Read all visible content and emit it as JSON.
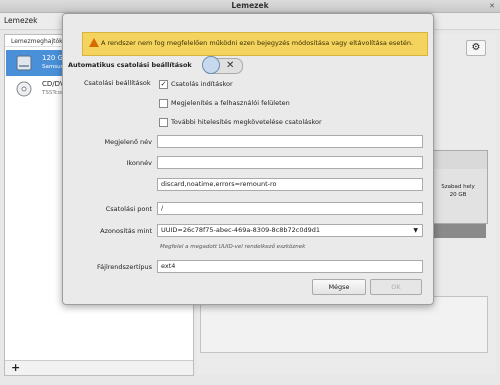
{
  "window": {
    "title": "Lemezek",
    "close_glyph": "✕"
  },
  "menubar": {
    "menu_label": "Lemezek"
  },
  "sidebar": {
    "header": "Lemezmeghajtók",
    "drives": [
      {
        "name": "120 GB",
        "sub": "Samsung"
      },
      {
        "name": "CD/DVD",
        "sub": "TSSTcorp"
      }
    ],
    "add_glyph": "+"
  },
  "content": {
    "gear_glyph": "⚙",
    "free_space": {
      "label": "Szabad hely",
      "size": "20 GB"
    }
  },
  "dialog": {
    "warning": "A rendszer nem fog megfelelően működni ezen bejegyzés módosítása vagy eltávolítása esetén.",
    "auto_section": "Automatikus csatolási beállítások",
    "toggle_glyph": "✕",
    "mount_options_label": "Csatolási beállítások",
    "checkboxes": [
      {
        "label": "Csatolás indításkor",
        "checked": true,
        "mark": "✓"
      },
      {
        "label": "Megjelenítés a felhasználói felületen",
        "checked": false,
        "mark": ""
      },
      {
        "label": "További hitelesítés megkövetelése csatoláskor",
        "checked": false,
        "mark": ""
      }
    ],
    "display_name_label": "Megjelenő név",
    "display_name_value": "",
    "icon_name_label": "Ikonnév",
    "icon_name_value": "",
    "options_value": "discard,noatime,errors=remount-ro",
    "mount_point_label": "Csatolási pont",
    "mount_point_value": "/",
    "identify_as_label": "Azonosítás mint",
    "identify_as_value": "UUID=26c78f75-abec-469a-8309-8c8b72c0d9d1",
    "identify_hint": "Megfelel a megadott UUID-vel rendelkező eszköznek",
    "fstype_label": "Fájlrendszertípus",
    "fstype_value": "ext4",
    "cancel_label": "Mégse",
    "ok_label": "OK"
  }
}
